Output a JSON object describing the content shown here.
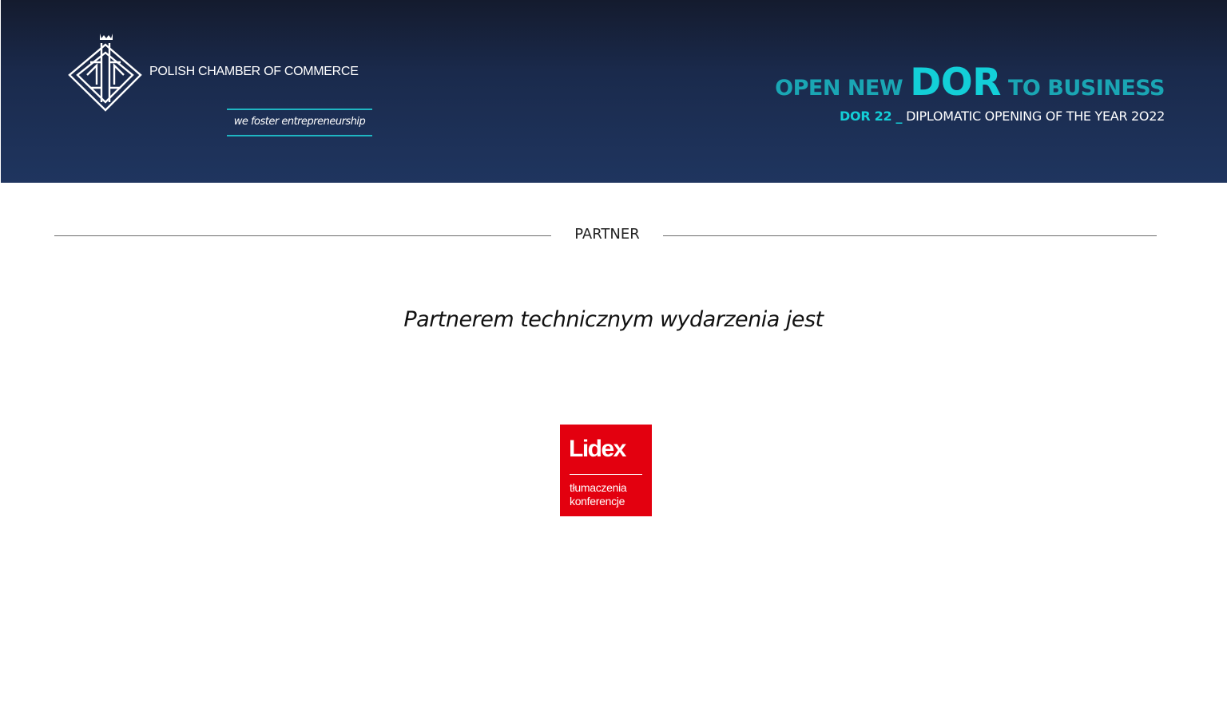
{
  "header": {
    "org_name": "POLISH CHAMBER OF COMMERCE",
    "tagline": "we foster entrepreneurship",
    "slogan": {
      "pre": "OPEN NEW",
      "highlight": "DOR",
      "post": "TO BUSINESS"
    },
    "subline": {
      "event_code": "DOR 22 _",
      "description": "DIPLOMATIC OPENING OF THE YEAR 2O22"
    },
    "logo_icon": "polish-chamber-emblem-icon"
  },
  "partner": {
    "section_title": "PARTNER",
    "intro_text": "Partnerem technicznym wydarzenia jest",
    "logo": {
      "name": "Lidex",
      "line1": "tłumaczenia",
      "line2": "konferencje",
      "color": "#e3000f"
    }
  },
  "colors": {
    "header_bg": "#1f355f",
    "accent_teal": "#13cfd8",
    "accent_teal_dark": "#1aa6b4"
  }
}
